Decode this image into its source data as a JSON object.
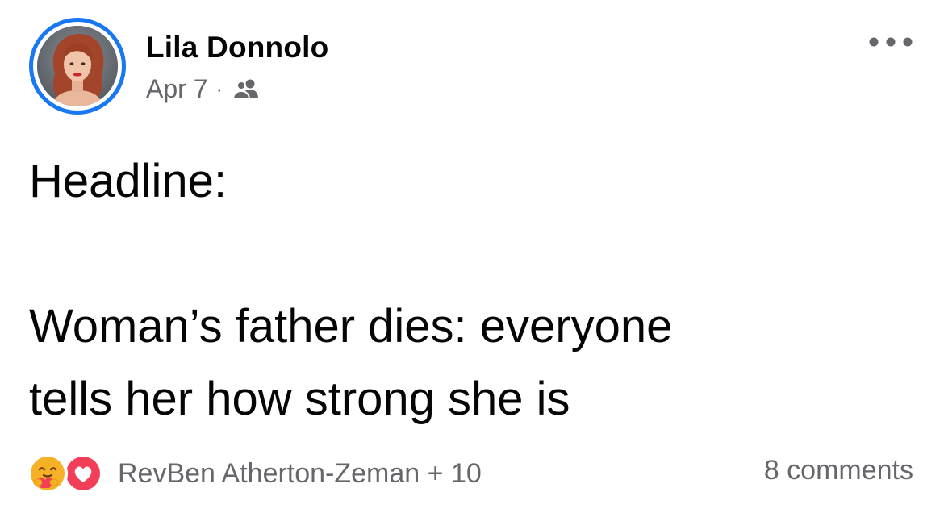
{
  "post": {
    "author": {
      "name": "Lila Donnolo"
    },
    "meta": {
      "date": "Apr 7",
      "separator": "·",
      "audience_icon": "friends-icon"
    },
    "more_icon": "more-options-icon",
    "body": {
      "line1": "Headline:",
      "line2": "Woman’s father dies: everyone",
      "line3": "tells her how strong she is"
    },
    "footer": {
      "reactions": [
        "care",
        "love"
      ],
      "reactors_text": "RevBen Atherton-Zeman + 10",
      "comments_text": "8 comments"
    }
  },
  "colors": {
    "accent": "#1877f2",
    "secondary_text": "#65676b",
    "primary_text": "#050505",
    "love": "#f33e58",
    "care": "#f7b125"
  }
}
